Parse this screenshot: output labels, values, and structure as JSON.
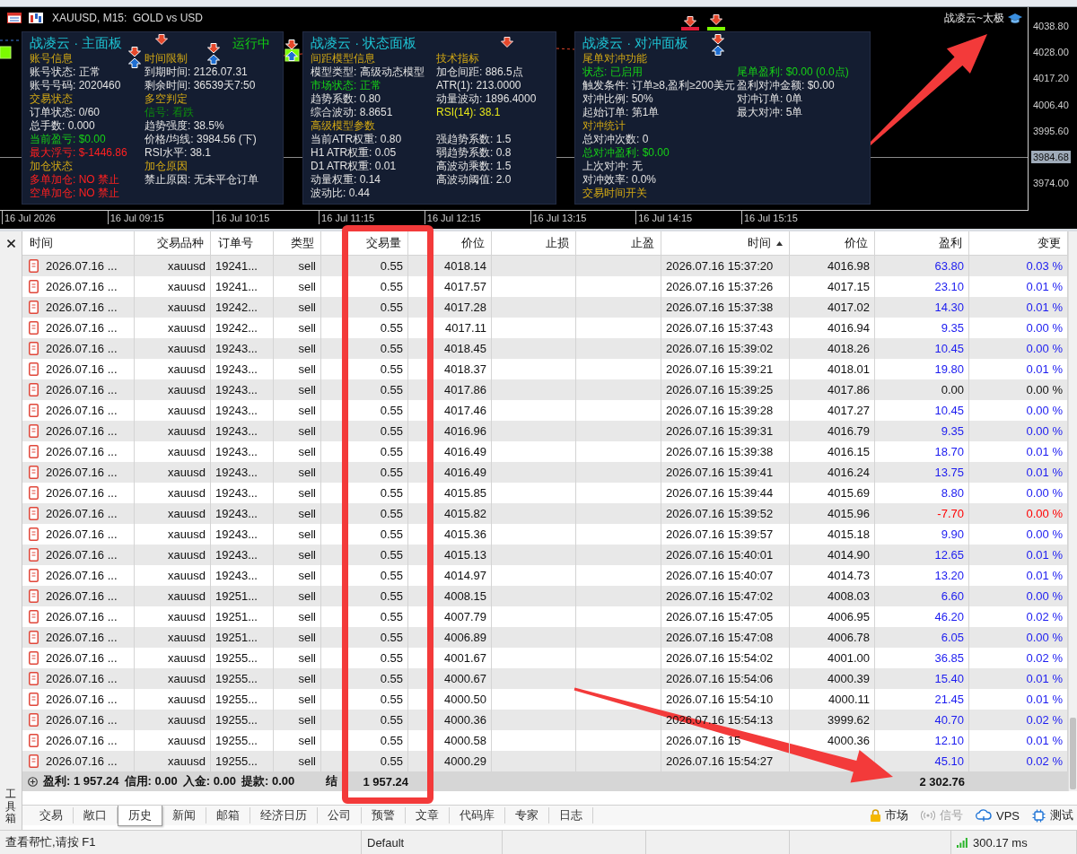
{
  "chart": {
    "title": "XAUUSD, M15:  GOLD vs USD",
    "badge": "战凌云~太极",
    "price_labels": [
      {
        "text": "4038.80",
        "current": false
      },
      {
        "text": "4028.00",
        "current": false
      },
      {
        "text": "4017.20",
        "current": false
      },
      {
        "text": "4006.40",
        "current": false
      },
      {
        "text": "3995.60",
        "current": false
      },
      {
        "text": "3984.68",
        "current": true
      },
      {
        "text": "3974.00",
        "current": false
      }
    ],
    "time_labels": [
      "16 Jul 2026",
      "16 Jul 09:15",
      "16 Jul 10:15",
      "16 Jul 11:15",
      "16 Jul 12:15",
      "16 Jul 13:15",
      "16 Jul 14:15",
      "16 Jul 15:15"
    ],
    "panels": [
      {
        "title": "战凌云 · 主面板",
        "status": "运行中",
        "rows": [
          [
            {
              "text": "账号信息",
              "kind": "heading"
            },
            {
              "text": "时间限制",
              "kind": "heading"
            }
          ],
          [
            {
              "text": "账号状态: 正常",
              "kind": "normal"
            },
            {
              "text": "到期时间: 2126.07.31",
              "kind": "normal"
            }
          ],
          [
            {
              "text": "账号号码: 2020460",
              "kind": "normal"
            },
            {
              "text": "剩余时间: 36539天7:50",
              "kind": "normal"
            }
          ],
          [
            {
              "text": "交易状态",
              "kind": "heading"
            },
            {
              "text": "多空判定",
              "kind": "heading"
            }
          ],
          [
            {
              "text": "订单状态: 0/60",
              "kind": "normal"
            },
            {
              "text": "信号: 看跌",
              "kind": "signal"
            }
          ],
          [
            {
              "text": "总手数: 0.000",
              "kind": "normal"
            },
            {
              "text": "趋势强度: 38.5%",
              "kind": "normal"
            }
          ],
          [
            {
              "text": "当前盈亏: $0.00",
              "kind": "positive"
            },
            {
              "text": "价格/均线: 3984.56 (下)",
              "kind": "normal"
            }
          ],
          [
            {
              "text": "最大浮亏: $-1446.86",
              "kind": "negative"
            },
            {
              "text": "RSI水平: 38.1",
              "kind": "normal"
            }
          ],
          [
            {
              "text": "加仓状态",
              "kind": "heading"
            },
            {
              "text": "加仓原因",
              "kind": "heading"
            }
          ],
          [
            {
              "text": "多单加仓: NO 禁止",
              "kind": "negative"
            },
            {
              "text": "禁止原因: 无未平仓订单",
              "kind": "normal"
            }
          ],
          [
            {
              "text": "空单加仓: NO 禁止",
              "kind": "negative"
            }
          ]
        ]
      },
      {
        "title": "战凌云 · 状态面板",
        "rows": [
          [
            {
              "text": "间距模型信息",
              "kind": "heading"
            },
            {
              "text": "技术指标",
              "kind": "heading"
            }
          ],
          [
            {
              "text": "模型类型: 高级动态模型",
              "kind": "normal"
            },
            {
              "text": "加仓间距: 886.5点",
              "kind": "normal"
            }
          ],
          [
            {
              "text": "市场状态: 正常",
              "kind": "positive"
            },
            {
              "text": "ATR(1): 213.0000",
              "kind": "normal"
            }
          ],
          [
            {
              "text": "趋势系数: 0.80",
              "kind": "normal"
            },
            {
              "text": "动量波动: 1896.4000",
              "kind": "normal"
            }
          ],
          [
            {
              "text": "综合波动: 8.8651",
              "kind": "normal"
            },
            {
              "text": "RSI(14): 38.1",
              "kind": "accent"
            }
          ],
          [
            {
              "text": "高级模型参数",
              "kind": "heading"
            }
          ],
          [
            {
              "text": "当前ATR权重: 0.80",
              "kind": "normal"
            },
            {
              "text": "强趋势系数: 1.5",
              "kind": "normal"
            }
          ],
          [
            {
              "text": "H1 ATR权重: 0.05",
              "kind": "normal"
            },
            {
              "text": "弱趋势系数: 0.8",
              "kind": "normal"
            }
          ],
          [
            {
              "text": "D1 ATR权重: 0.01",
              "kind": "normal"
            },
            {
              "text": "高波动乘数: 1.5",
              "kind": "normal"
            }
          ],
          [
            {
              "text": "动量权重: 0.14",
              "kind": "normal"
            },
            {
              "text": "高波动阈值: 2.0",
              "kind": "normal"
            }
          ],
          [
            {
              "text": "波动比: 0.44",
              "kind": "normal"
            }
          ]
        ]
      },
      {
        "title": "战凌云 · 对冲面板",
        "rows": [
          [
            {
              "text": "尾单对冲功能",
              "kind": "heading"
            }
          ],
          [
            {
              "text": "状态: 已启用",
              "kind": "positive"
            },
            {
              "text": "尾单盈利: $0.00 (0.0点)",
              "kind": "positive"
            }
          ],
          [
            {
              "text": "触发条件: 订单≥8,盈利≥200美元",
              "kind": "normal"
            },
            {
              "text": "盈利对冲金额: $0.00",
              "kind": "normal"
            }
          ],
          [
            {
              "text": "对冲比例: 50%",
              "kind": "normal"
            },
            {
              "text": "对冲订单: 0单",
              "kind": "normal"
            }
          ],
          [
            {
              "text": "起始订单: 第1单",
              "kind": "normal"
            },
            {
              "text": "最大对冲: 5单",
              "kind": "normal"
            }
          ],
          [
            {
              "text": "对冲统计",
              "kind": "heading"
            }
          ],
          [
            {
              "text": "总对冲次数: 0",
              "kind": "normal"
            }
          ],
          [
            {
              "text": "总对冲盈利: $0.00",
              "kind": "positive"
            }
          ],
          [
            {
              "text": "上次对冲: 无",
              "kind": "normal"
            }
          ],
          [
            {
              "text": "对冲效率: 0.0%",
              "kind": "normal"
            }
          ],
          [
            {
              "text": "交易时间开关",
              "kind": "heading"
            }
          ]
        ]
      }
    ]
  },
  "toolbox": {
    "title": "工具箱"
  },
  "table": {
    "columns": [
      {
        "label": "时间",
        "sorted": false
      },
      {
        "label": "交易品种",
        "sorted": false
      },
      {
        "label": "订单号",
        "sorted": false
      },
      {
        "label": "类型",
        "sorted": false
      },
      {
        "label": "交易量",
        "sorted": false
      },
      {
        "label": "价位",
        "sorted": false
      },
      {
        "label": "止损",
        "sorted": false
      },
      {
        "label": "止盈",
        "sorted": false
      },
      {
        "label": "时间",
        "sorted": true
      },
      {
        "label": "价位",
        "sorted": false
      },
      {
        "label": "盈利",
        "sorted": false
      },
      {
        "label": "变更",
        "sorted": false
      }
    ],
    "rows": [
      {
        "open_time": "2026.07.16 ...",
        "symbol": "xauusd",
        "order": "19241...",
        "type": "sell",
        "volume": "0.55",
        "open_price": "4018.14",
        "close_time": "2026.07.16 15:37:20",
        "close_price": "4016.98",
        "profit": "63.80",
        "change": "0.03 %",
        "kind": "gain"
      },
      {
        "open_time": "2026.07.16 ...",
        "symbol": "xauusd",
        "order": "19241...",
        "type": "sell",
        "volume": "0.55",
        "open_price": "4017.57",
        "close_time": "2026.07.16 15:37:26",
        "close_price": "4017.15",
        "profit": "23.10",
        "change": "0.01 %",
        "kind": "gain"
      },
      {
        "open_time": "2026.07.16 ...",
        "symbol": "xauusd",
        "order": "19242...",
        "type": "sell",
        "volume": "0.55",
        "open_price": "4017.28",
        "close_time": "2026.07.16 15:37:38",
        "close_price": "4017.02",
        "profit": "14.30",
        "change": "0.01 %",
        "kind": "gain"
      },
      {
        "open_time": "2026.07.16 ...",
        "symbol": "xauusd",
        "order": "19242...",
        "type": "sell",
        "volume": "0.55",
        "open_price": "4017.11",
        "close_time": "2026.07.16 15:37:43",
        "close_price": "4016.94",
        "profit": "9.35",
        "change": "0.00 %",
        "kind": "gain"
      },
      {
        "open_time": "2026.07.16 ...",
        "symbol": "xauusd",
        "order": "19243...",
        "type": "sell",
        "volume": "0.55",
        "open_price": "4018.45",
        "close_time": "2026.07.16 15:39:02",
        "close_price": "4018.26",
        "profit": "10.45",
        "change": "0.00 %",
        "kind": "gain"
      },
      {
        "open_time": "2026.07.16 ...",
        "symbol": "xauusd",
        "order": "19243...",
        "type": "sell",
        "volume": "0.55",
        "open_price": "4018.37",
        "close_time": "2026.07.16 15:39:21",
        "close_price": "4018.01",
        "profit": "19.80",
        "change": "0.01 %",
        "kind": "gain"
      },
      {
        "open_time": "2026.07.16 ...",
        "symbol": "xauusd",
        "order": "19243...",
        "type": "sell",
        "volume": "0.55",
        "open_price": "4017.86",
        "close_time": "2026.07.16 15:39:25",
        "close_price": "4017.86",
        "profit": "0.00",
        "change": "0.00 %",
        "kind": "flat"
      },
      {
        "open_time": "2026.07.16 ...",
        "symbol": "xauusd",
        "order": "19243...",
        "type": "sell",
        "volume": "0.55",
        "open_price": "4017.46",
        "close_time": "2026.07.16 15:39:28",
        "close_price": "4017.27",
        "profit": "10.45",
        "change": "0.00 %",
        "kind": "gain"
      },
      {
        "open_time": "2026.07.16 ...",
        "symbol": "xauusd",
        "order": "19243...",
        "type": "sell",
        "volume": "0.55",
        "open_price": "4016.96",
        "close_time": "2026.07.16 15:39:31",
        "close_price": "4016.79",
        "profit": "9.35",
        "change": "0.00 %",
        "kind": "gain"
      },
      {
        "open_time": "2026.07.16 ...",
        "symbol": "xauusd",
        "order": "19243...",
        "type": "sell",
        "volume": "0.55",
        "open_price": "4016.49",
        "close_time": "2026.07.16 15:39:38",
        "close_price": "4016.15",
        "profit": "18.70",
        "change": "0.01 %",
        "kind": "gain"
      },
      {
        "open_time": "2026.07.16 ...",
        "symbol": "xauusd",
        "order": "19243...",
        "type": "sell",
        "volume": "0.55",
        "open_price": "4016.49",
        "close_time": "2026.07.16 15:39:41",
        "close_price": "4016.24",
        "profit": "13.75",
        "change": "0.01 %",
        "kind": "gain"
      },
      {
        "open_time": "2026.07.16 ...",
        "symbol": "xauusd",
        "order": "19243...",
        "type": "sell",
        "volume": "0.55",
        "open_price": "4015.85",
        "close_time": "2026.07.16 15:39:44",
        "close_price": "4015.69",
        "profit": "8.80",
        "change": "0.00 %",
        "kind": "gain"
      },
      {
        "open_time": "2026.07.16 ...",
        "symbol": "xauusd",
        "order": "19243...",
        "type": "sell",
        "volume": "0.55",
        "open_price": "4015.82",
        "close_time": "2026.07.16 15:39:52",
        "close_price": "4015.96",
        "profit": "-7.70",
        "change": "0.00 %",
        "kind": "loss"
      },
      {
        "open_time": "2026.07.16 ...",
        "symbol": "xauusd",
        "order": "19243...",
        "type": "sell",
        "volume": "0.55",
        "open_price": "4015.36",
        "close_time": "2026.07.16 15:39:57",
        "close_price": "4015.18",
        "profit": "9.90",
        "change": "0.00 %",
        "kind": "gain"
      },
      {
        "open_time": "2026.07.16 ...",
        "symbol": "xauusd",
        "order": "19243...",
        "type": "sell",
        "volume": "0.55",
        "open_price": "4015.13",
        "close_time": "2026.07.16 15:40:01",
        "close_price": "4014.90",
        "profit": "12.65",
        "change": "0.01 %",
        "kind": "gain"
      },
      {
        "open_time": "2026.07.16 ...",
        "symbol": "xauusd",
        "order": "19243...",
        "type": "sell",
        "volume": "0.55",
        "open_price": "4014.97",
        "close_time": "2026.07.16 15:40:07",
        "close_price": "4014.73",
        "profit": "13.20",
        "change": "0.01 %",
        "kind": "gain"
      },
      {
        "open_time": "2026.07.16 ...",
        "symbol": "xauusd",
        "order": "19251...",
        "type": "sell",
        "volume": "0.55",
        "open_price": "4008.15",
        "close_time": "2026.07.16 15:47:02",
        "close_price": "4008.03",
        "profit": "6.60",
        "change": "0.00 %",
        "kind": "gain"
      },
      {
        "open_time": "2026.07.16 ...",
        "symbol": "xauusd",
        "order": "19251...",
        "type": "sell",
        "volume": "0.55",
        "open_price": "4007.79",
        "close_time": "2026.07.16 15:47:05",
        "close_price": "4006.95",
        "profit": "46.20",
        "change": "0.02 %",
        "kind": "gain"
      },
      {
        "open_time": "2026.07.16 ...",
        "symbol": "xauusd",
        "order": "19251...",
        "type": "sell",
        "volume": "0.55",
        "open_price": "4006.89",
        "close_time": "2026.07.16 15:47:08",
        "close_price": "4006.78",
        "profit": "6.05",
        "change": "0.00 %",
        "kind": "gain"
      },
      {
        "open_time": "2026.07.16 ...",
        "symbol": "xauusd",
        "order": "19255...",
        "type": "sell",
        "volume": "0.55",
        "open_price": "4001.67",
        "close_time": "2026.07.16 15:54:02",
        "close_price": "4001.00",
        "profit": "36.85",
        "change": "0.02 %",
        "kind": "gain"
      },
      {
        "open_time": "2026.07.16 ...",
        "symbol": "xauusd",
        "order": "19255...",
        "type": "sell",
        "volume": "0.55",
        "open_price": "4000.67",
        "close_time": "2026.07.16 15:54:06",
        "close_price": "4000.39",
        "profit": "15.40",
        "change": "0.01 %",
        "kind": "gain"
      },
      {
        "open_time": "2026.07.16 ...",
        "symbol": "xauusd",
        "order": "19255...",
        "type": "sell",
        "volume": "0.55",
        "open_price": "4000.50",
        "close_time": "2026.07.16 15:54:10",
        "close_price": "4000.11",
        "profit": "21.45",
        "change": "0.01 %",
        "kind": "gain"
      },
      {
        "open_time": "2026.07.16 ...",
        "symbol": "xauusd",
        "order": "19255...",
        "type": "sell",
        "volume": "0.55",
        "open_price": "4000.36",
        "close_time": "2026.07.16 15:54:13",
        "close_price": "3999.62",
        "profit": "40.70",
        "change": "0.02 %",
        "kind": "gain"
      },
      {
        "open_time": "2026.07.16 ...",
        "symbol": "xauusd",
        "order": "19255...",
        "type": "sell",
        "volume": "0.55",
        "open_price": "4000.58",
        "close_time": "2026.07.16 15",
        "close_price": "4000.36",
        "profit": "12.10",
        "change": "0.01 %",
        "kind": "gain"
      },
      {
        "open_time": "2026.07.16 ...",
        "symbol": "xauusd",
        "order": "19255...",
        "type": "sell",
        "volume": "0.55",
        "open_price": "4000.29",
        "close_time": "2026.07.16 15:54:27",
        "profit": "45.10",
        "change": "0.02 %",
        "kind": "gain"
      }
    ],
    "summary": {
      "items": [
        "盈利: 1 957.24",
        "信用: 0.00",
        "入金: 0.00",
        "提款: 0.00",
        "结"
      ],
      "balance": "1 957.24",
      "total_profit": "2 302.76"
    }
  },
  "tabs": [
    {
      "label": "交易",
      "selected": false
    },
    {
      "label": "敞口",
      "selected": false
    },
    {
      "label": "历史",
      "selected": true
    },
    {
      "label": "新闻",
      "selected": false
    },
    {
      "label": "邮箱",
      "selected": false
    },
    {
      "label": "经济日历",
      "selected": false
    },
    {
      "label": "公司",
      "selected": false
    },
    {
      "label": "预警",
      "selected": false
    },
    {
      "label": "文章",
      "selected": false
    },
    {
      "label": "代码库",
      "selected": false
    },
    {
      "label": "专家",
      "selected": false
    },
    {
      "label": "日志",
      "selected": false
    }
  ],
  "tools": [
    {
      "label": "市场",
      "kind": "lock",
      "disabled": false
    },
    {
      "label": "信号",
      "kind": "signal",
      "disabled": true
    },
    {
      "label": "VPS",
      "kind": "cloud",
      "disabled": false
    },
    {
      "label": "测试",
      "kind": "chip",
      "disabled": false
    }
  ],
  "status_bar": {
    "help": "查看帮忙,请按 F1",
    "profile": "Default",
    "ping": "300.17 ms"
  }
}
